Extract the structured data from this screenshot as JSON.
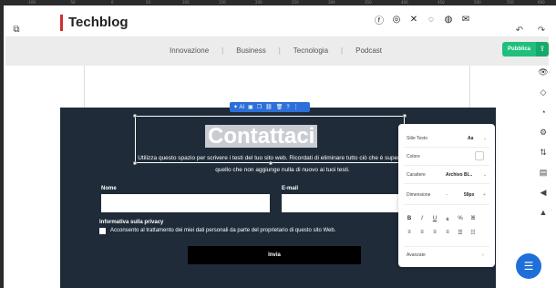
{
  "ruler": {
    "marks": [
      "-100",
      "-50",
      "0",
      "50",
      "100",
      "150",
      "200",
      "250",
      "300",
      "350",
      "400",
      "450",
      "500",
      "550",
      "600"
    ]
  },
  "site": {
    "title": "Techblog"
  },
  "nav": {
    "items": [
      "Innovazione",
      "Business",
      "Tecnologia",
      "Podcast"
    ]
  },
  "toolbar": {
    "publish_label": "Pubblica",
    "ai_label": "AI"
  },
  "contact": {
    "title": "Contattaci",
    "description": "Utilizza questo spazio per scrivere i testi del tuo sito web. Ricordati di eliminare tutto ciò che è superfluo e tutto quello che non aggiunge nulla di nuovo ai tuoi testi.",
    "name_label": "Nome",
    "email_label": "E-mail",
    "privacy_title": "Informativa sulla privacy",
    "privacy_text": "Acconsento al trattamento dei miei dati personali da parte del proprietario di questo sito Web.",
    "submit_label": "Invia"
  },
  "panel": {
    "text_style_label": "Stile Testo",
    "text_style_value": "Aa",
    "color_label": "Colore",
    "font_label": "Carattere",
    "font_value": "Archivo Bl...",
    "size_label": "Dimensione",
    "size_value": "59px",
    "advanced_label": "Avanzate"
  },
  "colors": {
    "accent": "#2d6fd8",
    "publish": "#1fbf7c",
    "brand_red": "#d12f2f",
    "section_bg": "#1f2b38"
  }
}
